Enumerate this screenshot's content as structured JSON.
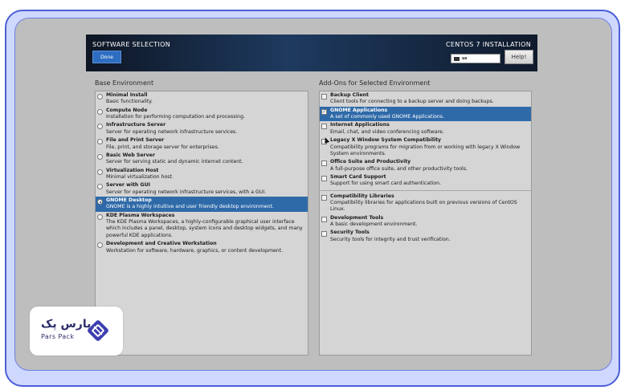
{
  "header": {
    "title": "SOFTWARE SELECTION",
    "install_title": "CENTOS 7 INSTALLATION",
    "done_label": "Done",
    "keyboard": "us",
    "help_label": "Help!"
  },
  "base_env": {
    "label": "Base Environment",
    "items": [
      {
        "title": "Minimal Install",
        "desc": "Basic functionality.",
        "selected": false
      },
      {
        "title": "Compute Node",
        "desc": "Installation for performing computation and processing.",
        "selected": false
      },
      {
        "title": "Infrastructure Server",
        "desc": "Server for operating network infrastructure services.",
        "selected": false
      },
      {
        "title": "File and Print Server",
        "desc": "File, print, and storage server for enterprises.",
        "selected": false
      },
      {
        "title": "Basic Web Server",
        "desc": "Server for serving static and dynamic internet content.",
        "selected": false
      },
      {
        "title": "Virtualization Host",
        "desc": "Minimal virtualization host.",
        "selected": false
      },
      {
        "title": "Server with GUI",
        "desc": "Server for operating network infrastructure services, with a GUI.",
        "selected": false
      },
      {
        "title": "GNOME Desktop",
        "desc": "GNOME is a highly intuitive and user friendly desktop environment.",
        "selected": true
      },
      {
        "title": "KDE Plasma Workspaces",
        "desc": "The KDE Plasma Workspaces, a highly-configurable graphical user interface which includes a panel, desktop, system icons and desktop widgets, and many powerful KDE applications.",
        "selected": false
      },
      {
        "title": "Development and Creative Workstation",
        "desc": "Workstation for software, hardware, graphics, or content development.",
        "selected": false
      }
    ]
  },
  "addons": {
    "label": "Add-Ons for Selected Environment",
    "items": [
      {
        "title": "Backup Client",
        "desc": "Client tools for connecting to a backup server and doing backups.",
        "checked": false,
        "selected": false
      },
      {
        "title": "GNOME Applications",
        "desc": "A set of commonly used GNOME Applications.",
        "checked": true,
        "selected": true
      },
      {
        "title": "Internet Applications",
        "desc": "Email, chat, and video conferencing software.",
        "checked": false,
        "selected": false
      },
      {
        "title": "Legacy X Window System Compatibility",
        "desc": "Compatibility programs for migration from or working with legacy X Window System environments.",
        "checked": false,
        "selected": false
      },
      {
        "title": "Office Suite and Productivity",
        "desc": "A full-purpose office suite, and other productivity tools.",
        "checked": false,
        "selected": false
      },
      {
        "title": "Smart Card Support",
        "desc": "Support for using smart card authentication.",
        "checked": false,
        "selected": false
      },
      {
        "title": "Compatibility Libraries",
        "desc": "Compatibility libraries for applications built on previous versions of CentOS Linux.",
        "checked": false,
        "selected": false,
        "divider_before": true
      },
      {
        "title": "Development Tools",
        "desc": "A basic development environment.",
        "checked": false,
        "selected": false
      },
      {
        "title": "Security Tools",
        "desc": "Security tools for integrity and trust verification.",
        "checked": false,
        "selected": false
      }
    ]
  },
  "logo": {
    "text_fa": "پارس پک",
    "text_en": "Pars Pack"
  }
}
